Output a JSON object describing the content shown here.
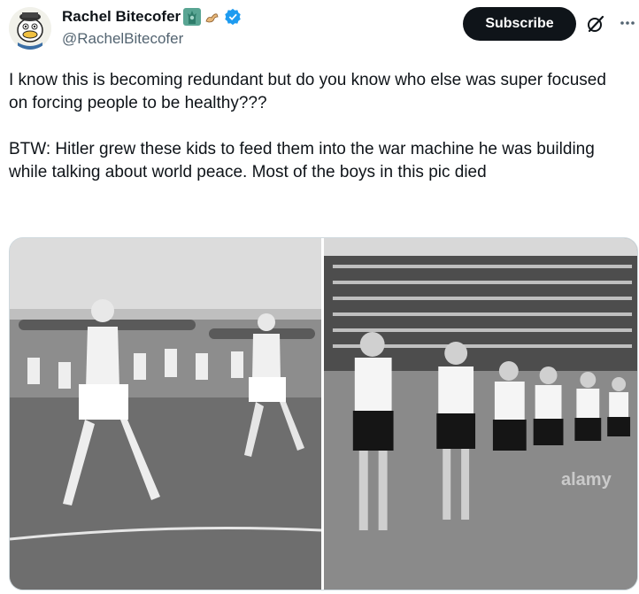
{
  "author": {
    "display_name": "Rachel Bitecofer",
    "handle": "@RachelBitecofer",
    "badges": [
      "statue-of-liberty-emoji",
      "flexed-arm-emoji",
      "verified-badge-icon"
    ]
  },
  "actions": {
    "subscribe_label": "Subscribe",
    "icons": [
      "grok-icon",
      "more-icon"
    ]
  },
  "tweet": {
    "paragraph_1": "I know this is becoming redundant but do you know who else was super focused on forcing people to be healthy???",
    "paragraph_2": "BTW: Hitler grew these kids to feed them into the war machine he was building while talking about world peace. Most of the boys in this pic died"
  },
  "media": {
    "watermark": "alamy"
  },
  "colors": {
    "text": "#0f1419",
    "secondary": "#536471",
    "verified": "#1d9bf0",
    "button": "#0f1419"
  }
}
